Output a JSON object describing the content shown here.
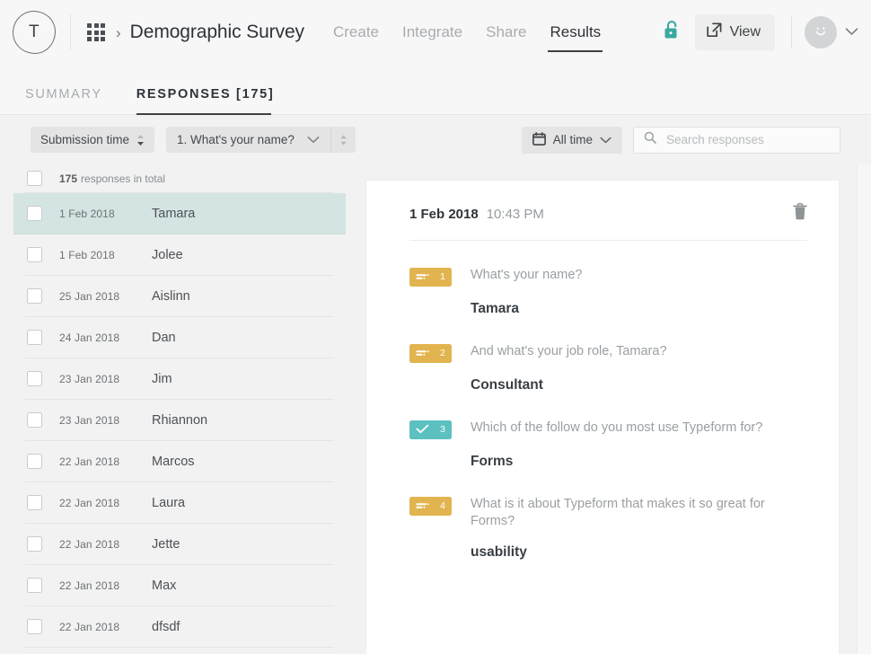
{
  "header": {
    "logo_letter": "T",
    "grid_icon": "apps-grid-icon",
    "breadcrumb_separator": "›",
    "form_title": "Demographic Survey",
    "nav": [
      {
        "label": "Create",
        "active": false
      },
      {
        "label": "Integrate",
        "active": false
      },
      {
        "label": "Share",
        "active": false
      },
      {
        "label": "Results",
        "active": true
      }
    ],
    "lock_icon": "unlocked-padlock-icon",
    "lock_color": "#3aa9a0",
    "view_button": {
      "label": "View",
      "icon": "external-link-icon"
    },
    "avatar": {
      "icon": "smiley-face-icon"
    },
    "account_chevron": "chevron-down-icon"
  },
  "tabs": [
    {
      "label": "SUMMARY",
      "active": false
    },
    {
      "label": "RESPONSES [175]",
      "active": true
    }
  ],
  "filterbar": {
    "sort_pill": {
      "label": "Submission time",
      "icon": "sort-arrows-icon"
    },
    "question_pill": {
      "label": "1. What's your name?",
      "chevron": "chevron-down-icon",
      "stepper": "stepper-arrows-icon"
    },
    "date_pill": {
      "label": "All time",
      "icon": "calendar-icon",
      "chevron": "chevron-down-icon"
    },
    "search": {
      "placeholder": "Search responses",
      "value": "",
      "icon": "search-icon"
    }
  },
  "list": {
    "total_count": "175",
    "total_label": "responses in total",
    "rows": [
      {
        "date": "1 Feb 2018",
        "name": "Tamara",
        "selected": true
      },
      {
        "date": "1 Feb 2018",
        "name": "Jolee",
        "selected": false
      },
      {
        "date": "25 Jan 2018",
        "name": "Aislinn",
        "selected": false
      },
      {
        "date": "24 Jan 2018",
        "name": "Dan",
        "selected": false
      },
      {
        "date": "23 Jan 2018",
        "name": "Jim",
        "selected": false
      },
      {
        "date": "23 Jan 2018",
        "name": "Rhiannon",
        "selected": false
      },
      {
        "date": "22 Jan 2018",
        "name": "Marcos",
        "selected": false
      },
      {
        "date": "22 Jan 2018",
        "name": "Laura",
        "selected": false
      },
      {
        "date": "22 Jan 2018",
        "name": "Jette",
        "selected": false
      },
      {
        "date": "22 Jan 2018",
        "name": "Max",
        "selected": false
      },
      {
        "date": "22 Jan 2018",
        "name": "dfsdf",
        "selected": false
      }
    ]
  },
  "detail": {
    "date": "1 Feb 2018",
    "time": "10:43 PM",
    "delete_icon": "trash-icon",
    "items": [
      {
        "number": "1",
        "badge_type": "gold",
        "badge_icon": "short-text-icon",
        "question": "What's your name?",
        "answer": "Tamara"
      },
      {
        "number": "2",
        "badge_type": "gold",
        "badge_icon": "short-text-icon",
        "question": "And what's your job role, Tamara?",
        "answer": "Consultant"
      },
      {
        "number": "3",
        "badge_type": "teal",
        "badge_icon": "check-icon",
        "question": "Which of the follow do you most use Typeform for?",
        "answer": "Forms"
      },
      {
        "number": "4",
        "badge_type": "gold",
        "badge_icon": "short-text-icon",
        "question": "What is it about Typeform that makes it so great for Forms?",
        "answer": "usability"
      }
    ]
  },
  "colors": {
    "badge_gold": "#e2b44f",
    "badge_teal": "#5cc0c0",
    "selected_row": "#d4e4e2",
    "accent_teal": "#3aa9a0"
  }
}
